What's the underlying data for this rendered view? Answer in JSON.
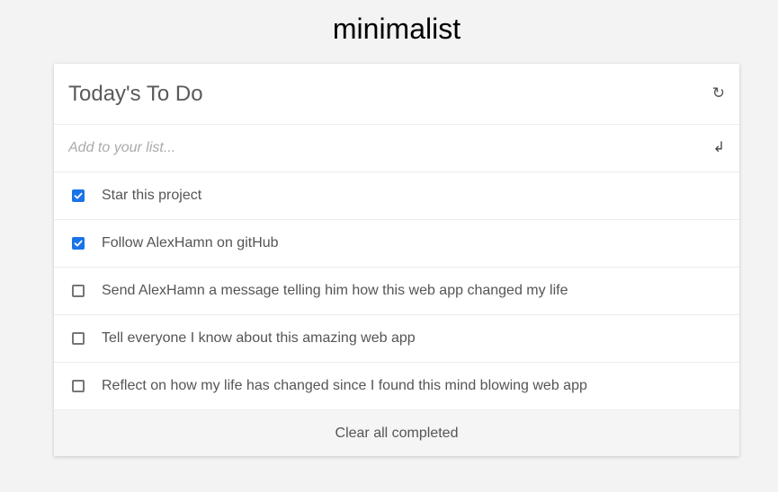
{
  "app": {
    "title": "minimalist"
  },
  "list": {
    "title": "Today's To Do",
    "refresh_icon": "refresh-icon",
    "add_placeholder": "Add to your list...",
    "add_value": "",
    "enter_icon": "enter-return-icon",
    "items": [
      {
        "text": "Star this project",
        "checked": true
      },
      {
        "text": "Follow AlexHamn on gitHub",
        "checked": true
      },
      {
        "text": "Send AlexHamn a message telling him how this web app changed my life",
        "checked": false
      },
      {
        "text": "Tell everyone I know about this amazing web app",
        "checked": false
      },
      {
        "text": "Reflect on how my life has changed since I found this mind blowing web app",
        "checked": false
      }
    ],
    "clear_label": "Clear all completed"
  },
  "colors": {
    "background": "#f3f3f3",
    "card": "#ffffff",
    "accent": "#1a73e8",
    "text": "#555555",
    "footer": "#f5f5f5"
  }
}
